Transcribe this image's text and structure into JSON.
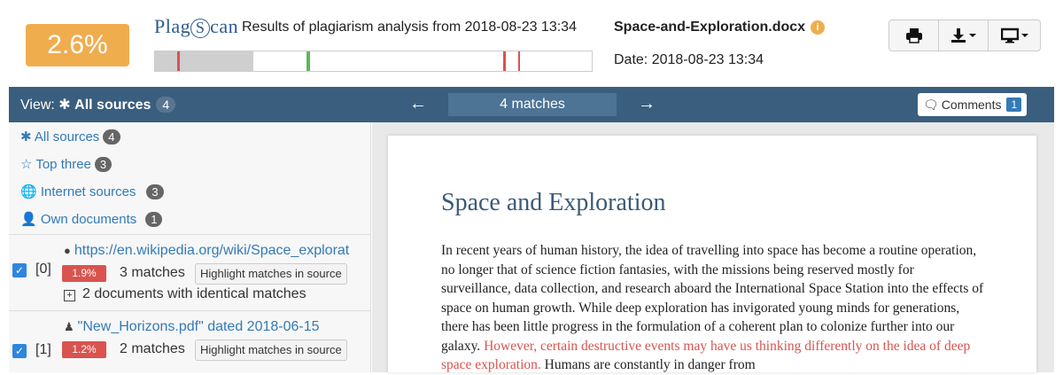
{
  "header": {
    "score": "2.6%",
    "logo_left": "Plag",
    "logo_mark": "S",
    "logo_right": "can",
    "results_title": "Results of plagiarism analysis from 2018-08-23 13:34",
    "doc_name": "Space-and-Exploration.docx",
    "date_text": "Date: 2018-08-23 13:34",
    "buttons": [
      "print-icon",
      "download-icon",
      "monitor-icon"
    ],
    "colors": {
      "score_bg": "#f0ad4e",
      "match_mark": "#d9534f",
      "green_mark": "#5cb85c"
    }
  },
  "toolbar": {
    "view_prefix": "View:",
    "view_value": "All sources",
    "view_count": "4",
    "matches": "4 matches",
    "comments_label": "Comments",
    "comments_count": "1"
  },
  "filters": [
    {
      "icon": "asterisk-icon",
      "label": "All sources",
      "count": "4"
    },
    {
      "icon": "star-icon",
      "label": "Top three",
      "count": "3"
    },
    {
      "icon": "globe-icon",
      "label": "Internet sources",
      "count": "3"
    },
    {
      "icon": "user-icon",
      "label": "Own documents",
      "count": "1"
    }
  ],
  "sources": [
    {
      "index": "[0]",
      "icon": "globe-icon",
      "title": "https://en.wikipedia.org/wiki/Space_explorat",
      "percent": "1.9%",
      "matches": "3 matches",
      "highlight": "Highlight matches in source",
      "identical": "2 documents with identical matches"
    },
    {
      "index": "[1]",
      "icon": "user-icon",
      "title": "\"New_Horizons.pdf\" dated 2018-06-15",
      "percent": "1.2%",
      "matches": "2 matches",
      "highlight": "Highlight matches in source"
    }
  ],
  "document": {
    "heading": "Space and Exploration",
    "text_plain": "In recent years of human history, the idea of travelling into space has become a routine operation, no longer that of science fiction fantasies, with the missions being reserved mostly for surveillance, data collection, and research aboard the International Space Station into the effects of space on human growth. While deep exploration has invigorated young minds for generations, there has been little progress in the formulation of a coherent plan to colonize further into our galaxy. ",
    "text_match": "However, certain destructive events may have us thinking differently on the idea of deep space exploration.",
    "text_after": " Humans are constantly in danger from"
  }
}
